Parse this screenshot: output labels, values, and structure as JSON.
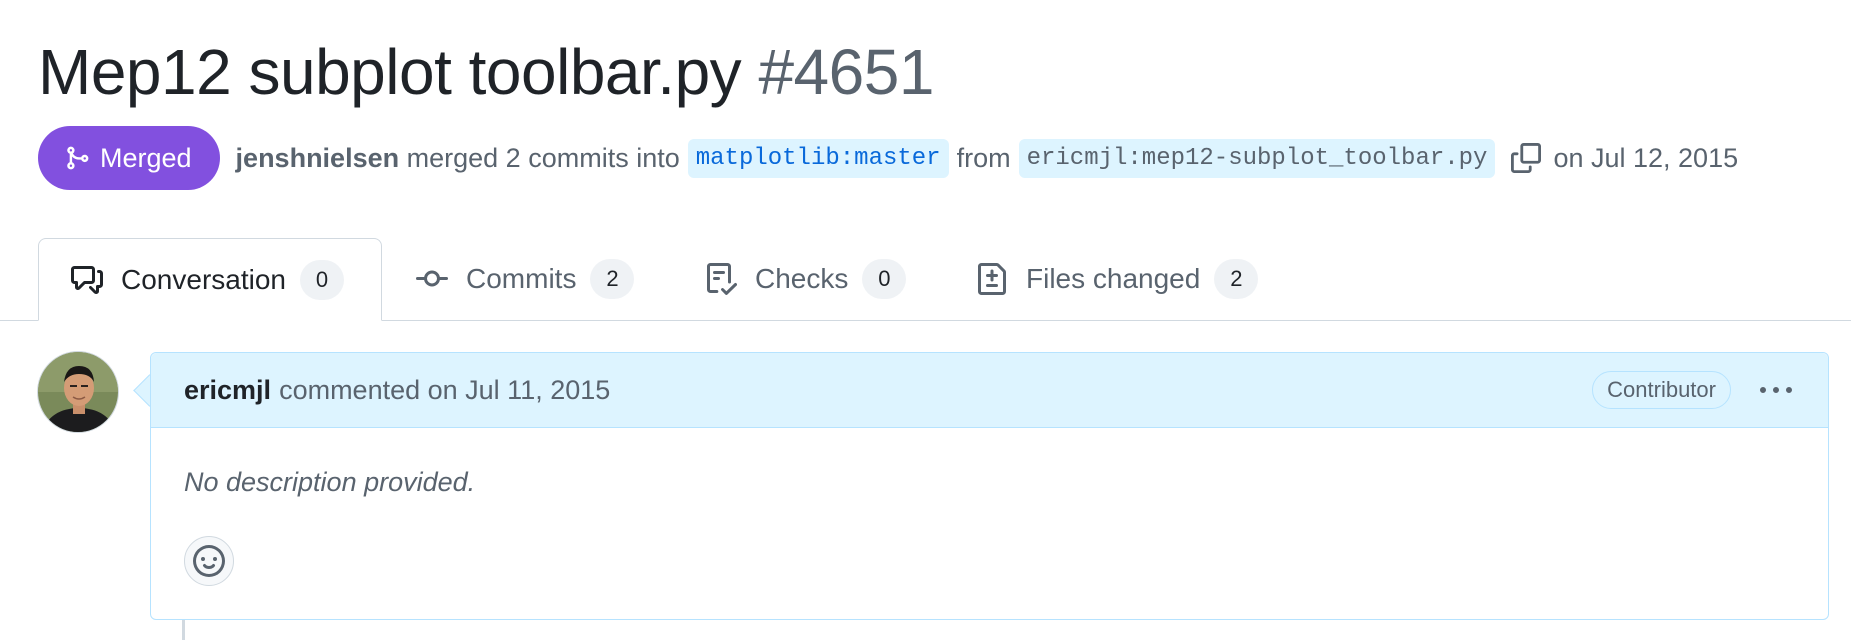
{
  "pr": {
    "title": "Mep12 subplot toolbar.py",
    "number": "#4651",
    "state_label": "Merged",
    "state_color": "#8250df",
    "author": "jenshnielsen",
    "action_text": "merged 2 commits into",
    "base_branch": "matplotlib:master",
    "from_text": "from",
    "head_branch": "ericmjl:mep12-subplot_toolbar.py",
    "date_text": "on Jul 12, 2015"
  },
  "tabs": [
    {
      "label": "Conversation",
      "count": "0",
      "icon": "comment-discussion-icon"
    },
    {
      "label": "Commits",
      "count": "2",
      "icon": "git-commit-icon"
    },
    {
      "label": "Checks",
      "count": "0",
      "icon": "checklist-icon"
    },
    {
      "label": "Files changed",
      "count": "2",
      "icon": "file-diff-icon"
    }
  ],
  "comment": {
    "author": "ericmjl",
    "action_text": "commented on Jul 11, 2015",
    "role_badge": "Contributor",
    "body": "No description provided.",
    "avatar_icon": "user-avatar",
    "reaction_icon": "smiley-icon",
    "menu_icon": "kebab-horizontal-icon"
  },
  "colors": {
    "accent": "#0969da",
    "merged": "#8250df",
    "comment_header_bg": "#ddf4ff",
    "muted_text": "#59636e"
  }
}
